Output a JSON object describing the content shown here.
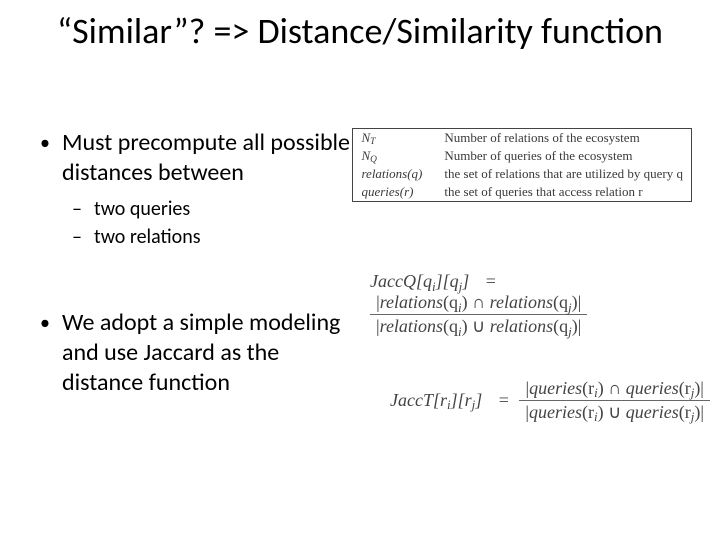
{
  "title": "“Similar”? => Distance/Similarity function",
  "bullets": {
    "b1": "Must precompute all possible distances between",
    "b1a": "two queries",
    "b1b": "two relations",
    "b2": "We adopt a simple modeling and use Jaccard as the distance function"
  },
  "notation": {
    "rows": [
      {
        "sym_html": "N<span class=\"sub\">T</span>",
        "desc": "Number of relations of the ecosystem"
      },
      {
        "sym_html": "N<span class=\"sub\">Q</span>",
        "desc": "Number of queries of the ecosystem"
      },
      {
        "sym_html": "relations(q)",
        "desc": "the set of relations that are utilized by query q"
      },
      {
        "sym_html": "queries(r)",
        "desc": "the set of queries that access relation r"
      }
    ]
  },
  "formulas": {
    "jaccq": {
      "name_html": "JaccQ[q<span class=\"subi\">i</span>][q<span class=\"subi\">j</span>]",
      "num_html": "|<span class=\"ital\">relations</span>(q<span class=\"subi\">i</span>) ∩ <span class=\"ital\">relations</span>(q<span class=\"subi\">j</span>)|",
      "den_html": "|<span class=\"ital\">relations</span>(q<span class=\"subi\">i</span>) ∪ <span class=\"ital\">relations</span>(q<span class=\"subi\">j</span>)|"
    },
    "jacct": {
      "name_html": "JaccT[r<span class=\"subi\">i</span>][r<span class=\"subi\">j</span>]",
      "num_html": "|<span class=\"ital\">queries</span>(r<span class=\"subi\">i</span>) ∩ <span class=\"ital\">queries</span>(r<span class=\"subi\">j</span>)|",
      "den_html": "|<span class=\"ital\">queries</span>(r<span class=\"subi\">i</span>) ∪ <span class=\"ital\">queries</span>(r<span class=\"subi\">j</span>)|"
    }
  }
}
